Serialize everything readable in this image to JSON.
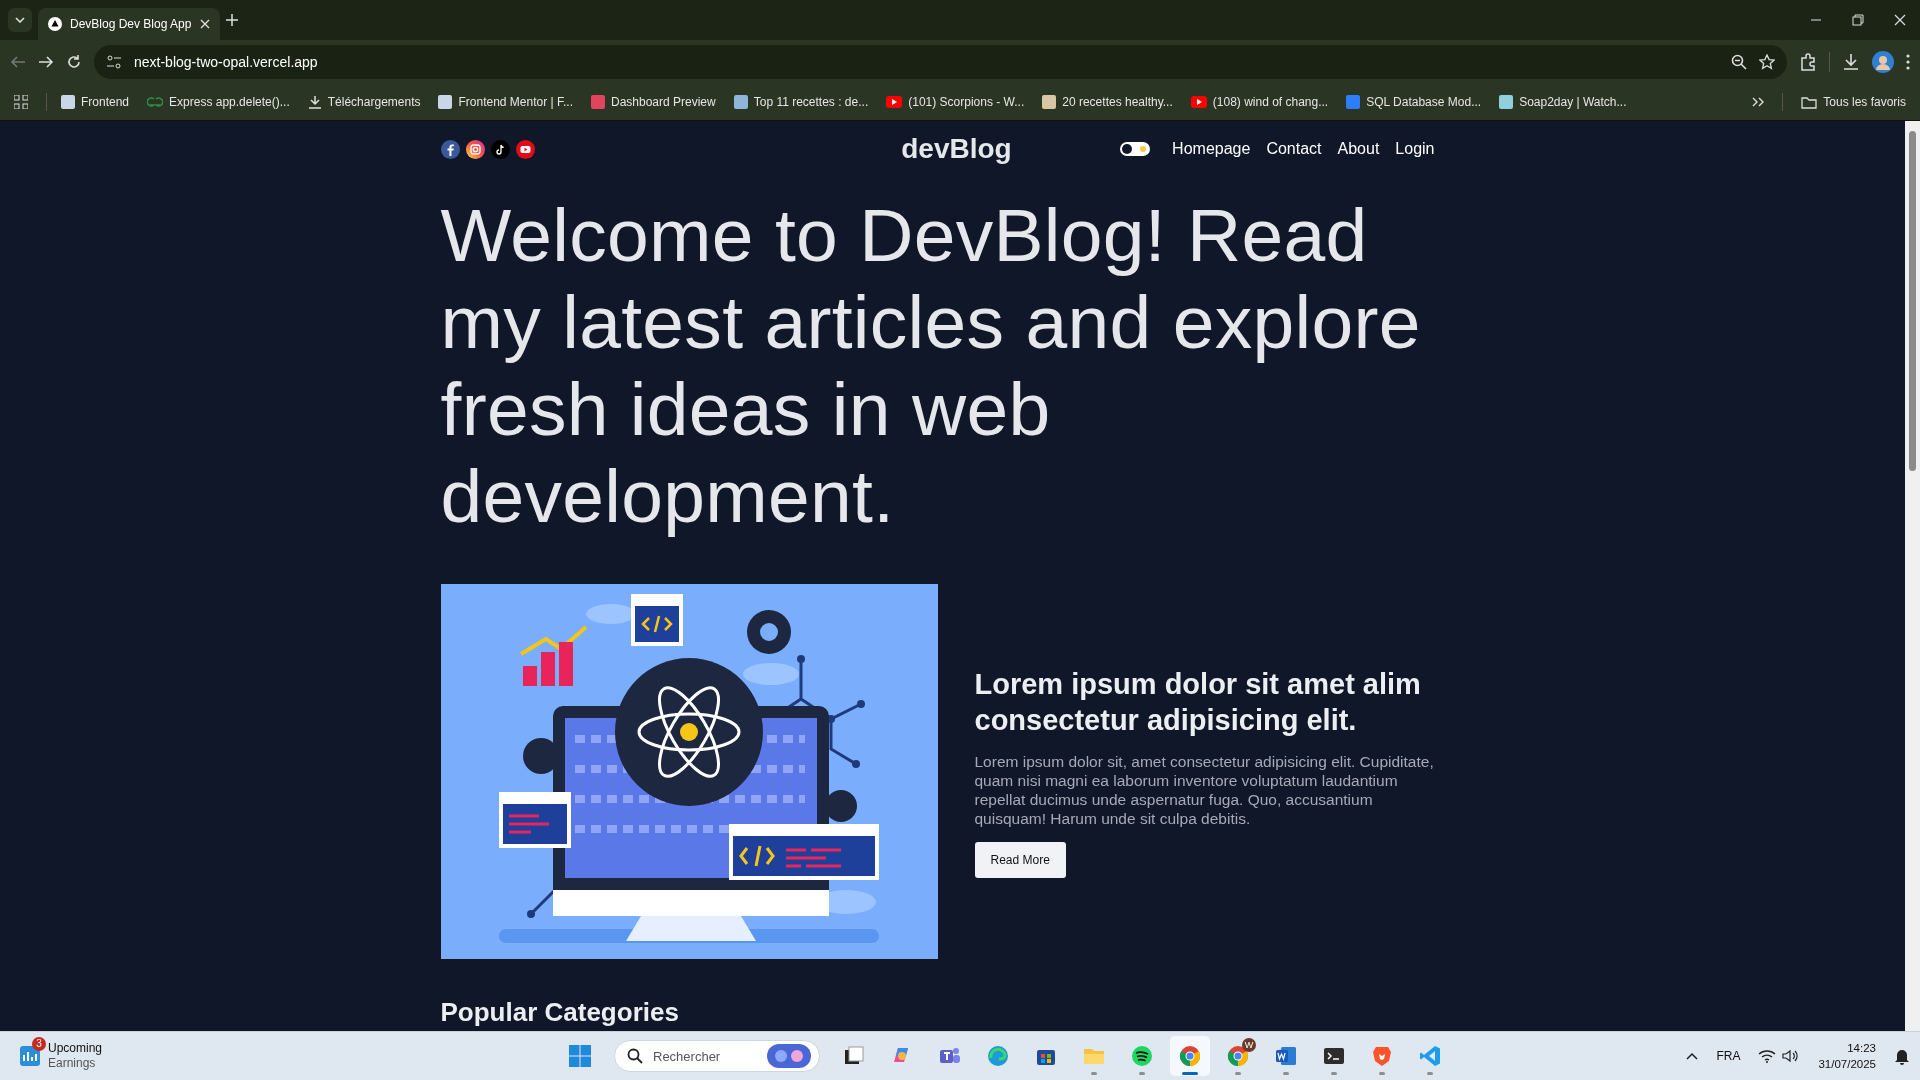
{
  "browser": {
    "tab": {
      "title": "DevBlog Dev Blog App",
      "selected": true
    },
    "url": "next-blog-two-opal.vercel.app",
    "bookmarks": [
      {
        "label": "Frontend",
        "kind": "site",
        "color": "#c9d6e8"
      },
      {
        "label": "Express app.delete()...",
        "kind": "gfg",
        "color": "#2f8d46"
      },
      {
        "label": "Téléchargements",
        "kind": "download",
        "color": "#e0e0e0"
      },
      {
        "label": "Frontend Mentor | F...",
        "kind": "site",
        "color": "#c9d6e8"
      },
      {
        "label": "Dashboard Preview",
        "kind": "site",
        "color": "#e2445c"
      },
      {
        "label": "Top 11 recettes : de...",
        "kind": "site",
        "color": "#8fb6d8"
      },
      {
        "label": "(101) Scorpions - W...",
        "kind": "youtube",
        "color": "#ff0000"
      },
      {
        "label": "20 recettes healthy...",
        "kind": "site",
        "color": "#d8c6a4"
      },
      {
        "label": "(108) wind of chang...",
        "kind": "youtube",
        "color": "#ff0000"
      },
      {
        "label": "SQL Database Mod...",
        "kind": "site",
        "color": "#2d7ff9"
      },
      {
        "label": "Soap2day | Watch...",
        "kind": "site",
        "color": "#8fd0dc"
      }
    ],
    "all_bookmarks": "Tous les favoris"
  },
  "site": {
    "logo": "devBlog",
    "theme_toggle": {
      "on": false
    },
    "nav": [
      "Homepage",
      "Contact",
      "About",
      "Login"
    ],
    "hero": "Welcome to DevBlog! Read my latest articles and explore fresh ideas in web development.",
    "post": {
      "title": "Lorem ipsum dolor sit amet alim consectetur adipisicing elit.",
      "excerpt": "Lorem ipsum dolor sit, amet consectetur adipisicing elit. Cupiditate, quam nisi magni ea laborum inventore voluptatum laudantium repellat ducimus unde aspernatur fuga. Quo, accusantium quisquam! Harum unde sit culpa debitis.",
      "button": "Read More"
    },
    "section_title": "Popular Categories"
  },
  "taskbar": {
    "widget": {
      "badge": "3",
      "title": "Upcoming",
      "subtitle": "Earnings"
    },
    "search": {
      "placeholder": "Rechercher"
    },
    "apps": [
      {
        "kind": "taskview",
        "running": false,
        "selected": false
      },
      {
        "kind": "copilot",
        "running": false,
        "selected": false
      },
      {
        "kind": "teams",
        "running": false,
        "selected": false
      },
      {
        "kind": "edge",
        "running": false,
        "selected": false
      },
      {
        "kind": "store",
        "running": false,
        "selected": false
      },
      {
        "kind": "explorer",
        "running": true,
        "selected": false
      },
      {
        "kind": "spotify",
        "running": true,
        "selected": false
      },
      {
        "kind": "chrome",
        "running": true,
        "selected": true
      },
      {
        "kind": "chrome",
        "running": true,
        "selected": false,
        "badge": "W"
      },
      {
        "kind": "word",
        "running": true,
        "selected": false
      },
      {
        "kind": "terminal",
        "running": true,
        "selected": false
      },
      {
        "kind": "brave",
        "running": true,
        "selected": false
      },
      {
        "kind": "vscode",
        "running": true,
        "selected": false
      }
    ],
    "language": "FRA",
    "time": "14:23",
    "date": "31/07/2025"
  }
}
